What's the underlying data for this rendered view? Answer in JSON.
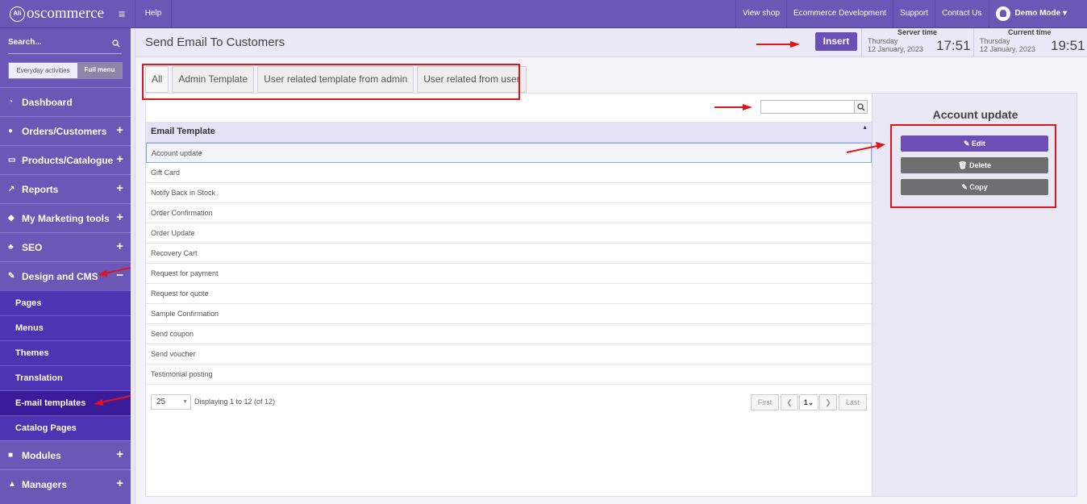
{
  "topbar": {
    "logo_text": "oscommerce",
    "logo_mark": "Ali",
    "help": "Help",
    "nav": [
      "View shop",
      "Ecommerce Development",
      "Support",
      "Contact Us"
    ],
    "user": "Demo Mode ▾"
  },
  "sidebar": {
    "search_placeholder": "Search...",
    "toggle_everyday": "Everyday activities",
    "toggle_full": "Full menu",
    "menu": [
      {
        "label": "Dashboard",
        "icon": "dashboard-icon",
        "expand": ""
      },
      {
        "label": "Orders/Customers",
        "icon": "users-icon",
        "expand": "+"
      },
      {
        "label": "Products/Catalogue",
        "icon": "folder-icon",
        "expand": "+"
      },
      {
        "label": "Reports",
        "icon": "chart-icon",
        "expand": "+"
      },
      {
        "label": "My Marketing tools",
        "icon": "tag-icon",
        "expand": "+"
      },
      {
        "label": "SEO",
        "icon": "sitemap-icon",
        "expand": "+"
      },
      {
        "label": "Design and CMS",
        "icon": "brush-icon",
        "expand": "−"
      }
    ],
    "submenu": [
      "Pages",
      "Menus",
      "Themes",
      "Translation",
      "E-mail templates",
      "Catalog Pages"
    ],
    "menu_after": [
      {
        "label": "Modules",
        "icon": "puzzle-icon",
        "expand": "+"
      },
      {
        "label": "Managers",
        "icon": "user-icon",
        "expand": "+"
      }
    ]
  },
  "header": {
    "title": "Send Email To Customers",
    "insert": "Insert",
    "server_time": {
      "label": "Server time",
      "day": "Thursday",
      "date": "12 January, 2023",
      "clock": "17:51"
    },
    "current_time": {
      "label": "Current time",
      "day": "Thursday",
      "date": "12 January, 2023",
      "clock": "19:51"
    }
  },
  "tabs": [
    "All",
    "Admin Template",
    "User related template from admin",
    "User related from user"
  ],
  "table": {
    "column": "Email Template",
    "rows": [
      "Account update",
      "Gift Card",
      "Notify Back in Stock",
      "Order Confirmation",
      "Order Update",
      "Recovery Cart",
      "Request for payment",
      "Request for quote",
      "Sample Confirmation",
      "Send coupon",
      "Send voucher",
      "Testimonial posting"
    ],
    "selected_index": 0,
    "per_page": "25",
    "display_text": "Displaying 1 to 12 (of 12)",
    "pager": {
      "first": "First",
      "page": "1",
      "last": "Last"
    }
  },
  "info": {
    "title": "Account update",
    "edit": "Edit",
    "delete": "Delete",
    "copy": "Copy"
  },
  "colors": {
    "brand": "#6a57b6",
    "sidebar_sub": "#4c34b2",
    "annotation": "#e2141b"
  }
}
